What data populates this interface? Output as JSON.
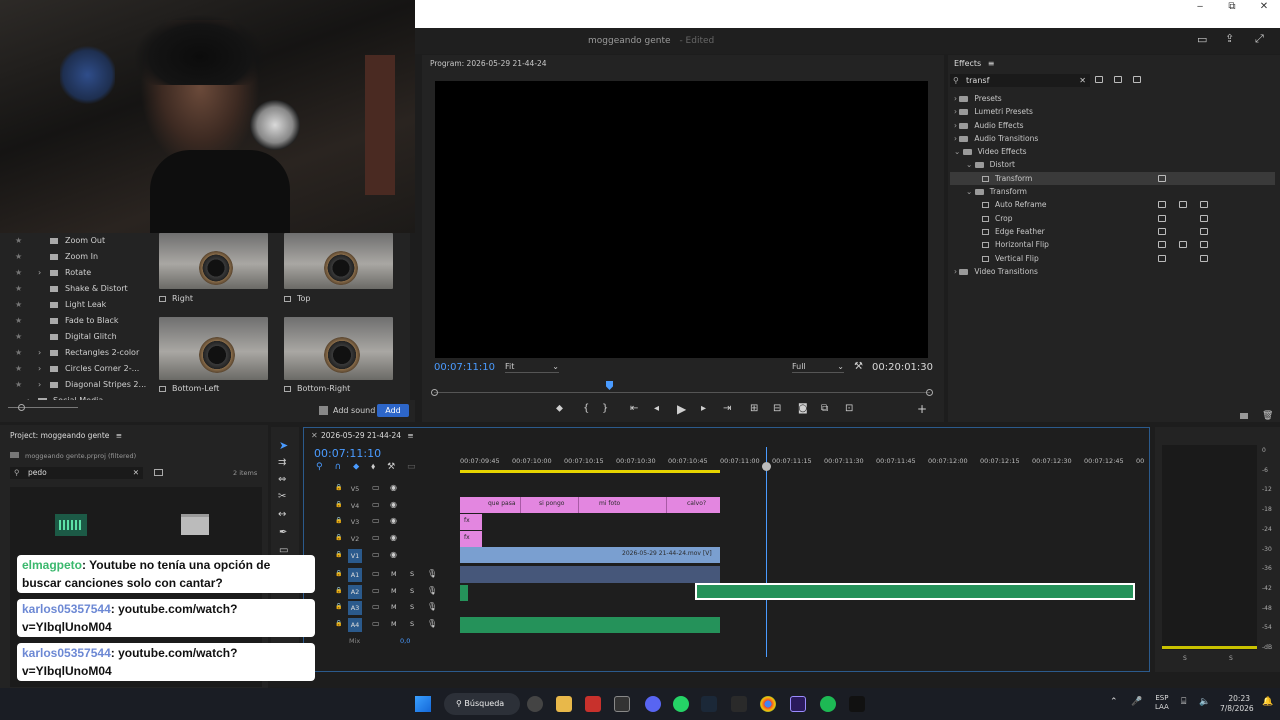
{
  "window": {
    "title": "moggeando gente",
    "edited": "- Edited",
    "controls": [
      "‒",
      "⧉",
      "✕"
    ]
  },
  "effect_presets_left": {
    "items": [
      {
        "label": "Zoom Out",
        "expandable": false
      },
      {
        "label": "Zoom In",
        "expandable": false
      },
      {
        "label": "Rotate",
        "expandable": true
      },
      {
        "label": "Shake & Distort",
        "expandable": false
      },
      {
        "label": "Light Leak",
        "expandable": false
      },
      {
        "label": "Fade to Black",
        "expandable": false
      },
      {
        "label": "Digital Glitch",
        "expandable": false
      },
      {
        "label": "Rectangles 2-color",
        "expandable": true
      },
      {
        "label": "Circles Corner 2-...",
        "expandable": true
      },
      {
        "label": "Diagonal Stripes 2...",
        "expandable": true
      }
    ],
    "folder": "Social Media",
    "thumbs": [
      "Right",
      "Top",
      "Bottom-Left",
      "Bottom-Right"
    ],
    "add_sound": "Add sound",
    "add_button": "Add"
  },
  "program_monitor": {
    "title": "Program: 2026-05-29 21-44-24",
    "timecode": "00:07:11:10",
    "fit": "Fit",
    "quality": "Full",
    "duration": "00:20:01:30"
  },
  "effects_panel": {
    "title": "Effects",
    "search": "transf",
    "tree": [
      {
        "label": "Presets",
        "level": 0,
        "type": "folder",
        "open": false
      },
      {
        "label": "Lumetri Presets",
        "level": 0,
        "type": "folder",
        "open": false
      },
      {
        "label": "Audio Effects",
        "level": 0,
        "type": "folder",
        "open": false
      },
      {
        "label": "Audio Transitions",
        "level": 0,
        "type": "folder",
        "open": false
      },
      {
        "label": "Video Effects",
        "level": 0,
        "type": "folder",
        "open": true
      },
      {
        "label": "Distort",
        "level": 1,
        "type": "folder",
        "open": true
      },
      {
        "label": "Transform",
        "level": 2,
        "type": "fx",
        "selected": true
      },
      {
        "label": "Transform",
        "level": 1,
        "type": "folder",
        "open": true
      },
      {
        "label": "Auto Reframe",
        "level": 2,
        "type": "fx"
      },
      {
        "label": "Crop",
        "level": 2,
        "type": "fx"
      },
      {
        "label": "Edge Feather",
        "level": 2,
        "type": "fx"
      },
      {
        "label": "Horizontal Flip",
        "level": 2,
        "type": "fx"
      },
      {
        "label": "Vertical Flip",
        "level": 2,
        "type": "fx"
      },
      {
        "label": "Video Transitions",
        "level": 0,
        "type": "folder",
        "open": false
      }
    ]
  },
  "project_panel": {
    "title": "Project: moggeando gente",
    "file": "moggeando gente.prproj (filtered)",
    "search": "pedo",
    "count": "2 items"
  },
  "timeline": {
    "sequence": "2026-05-29 21-44-24",
    "timecode": "00:07:11:10",
    "ruler": [
      "00:07:09:45",
      "00:07:10:00",
      "00:07:10:15",
      "00:07:10:30",
      "00:07:10:45",
      "00:07:11:00",
      "00:07:11:15",
      "00:07:11:30",
      "00:07:11:45",
      "00:07:12:00",
      "00:07:12:15",
      "00:07:12:30",
      "00:07:12:45",
      "00"
    ],
    "video_tracks": [
      "V5",
      "V4",
      "V3",
      "V2",
      "V1"
    ],
    "audio_tracks": [
      "A1",
      "A2",
      "A3",
      "A4"
    ],
    "mix": "Mix",
    "mix_value": "0,0",
    "v4_clips": [
      "que pasa",
      "si pongo",
      "mi foto",
      "calvo?"
    ],
    "v1_clip": "2026-05-29 21-44-24.mov [V]",
    "fx_label": "fx",
    "m": "M",
    "s": "S"
  },
  "meter_scale": [
    "0",
    "-6",
    "-12",
    "-18",
    "-24",
    "-30",
    "-36",
    "-42",
    "-48",
    "-54",
    "-dB"
  ],
  "chat": [
    {
      "user": "elmagpeto",
      "text": ": Youtube no tenía una opción de buscar canciones solo con cantar?",
      "color": "green"
    },
    {
      "user": "karlos05357544",
      "text": ": youtube.com/watch? v=YIbqlUnoM04",
      "color": "blue"
    },
    {
      "user": "karlos05357544",
      "text": ": youtube.com/watch? v=YIbqlUnoM04",
      "color": "blue"
    }
  ],
  "taskbar": {
    "search": "Búsqueda",
    "lang_top": "ESP",
    "lang_bottom": "LAA",
    "time": "20:23",
    "date": "7/8/2026"
  }
}
